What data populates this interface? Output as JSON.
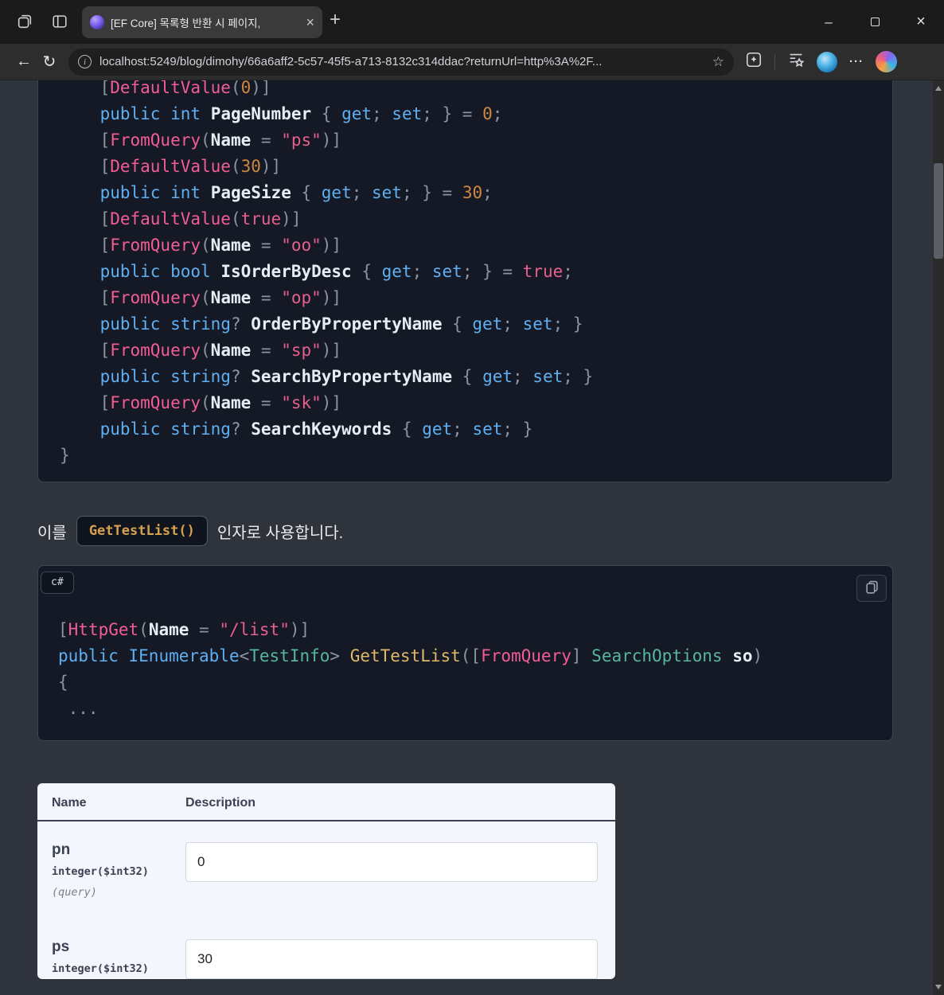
{
  "colors": {
    "page_bg": "#2e333c",
    "code_bg": "#141925",
    "keyword_blue": "#5fb0f2",
    "attribute_pink": "#f25d94",
    "string_pink": "#e5608c",
    "number_orange": "#cf8740",
    "function_gold": "#dfb868",
    "type_teal": "#56b6a2",
    "inline_code_gold": "#d7a14d",
    "table_bg": "#f3f6fc"
  },
  "chrome": {
    "tab": {
      "title": "[EF Core] 목록형 반환 시 페이지,"
    },
    "url": "localhost:5249/blog/dimohy/66a6aff2-5c57-45f5-a713-8132c314ddac?returnUrl=http%3A%2F...",
    "glyphs": {
      "back": "←",
      "refresh": "↻",
      "info": "i",
      "star": "☆",
      "new_tab": "+",
      "tab_close": "×",
      "minimize": "–",
      "window_close": "×",
      "menu": "···"
    }
  },
  "main": {
    "code_block_1": {
      "lines": [
        [
          [
            "pu",
            "    ["
          ],
          [
            "at",
            "DefaultValue"
          ],
          [
            "pu",
            "("
          ],
          [
            "nu",
            "0"
          ],
          [
            "pu",
            ")]"
          ]
        ],
        [
          [
            "pu",
            "    "
          ],
          [
            "kw",
            "public"
          ],
          [
            "pu",
            " "
          ],
          [
            "kw",
            "int"
          ],
          [
            "pu",
            " "
          ],
          [
            "pr",
            "PageNumber"
          ],
          [
            "pu",
            " { "
          ],
          [
            "kw",
            "get"
          ],
          [
            "pu",
            "; "
          ],
          [
            "kw",
            "set"
          ],
          [
            "pu",
            "; } = "
          ],
          [
            "nu",
            "0"
          ],
          [
            "pu",
            ";"
          ]
        ],
        [
          [
            "pu",
            "    ["
          ],
          [
            "at",
            "FromQuery"
          ],
          [
            "pu",
            "("
          ],
          [
            "pr",
            "Name"
          ],
          [
            "pu",
            " = "
          ],
          [
            "st",
            "\"ps\""
          ],
          [
            "pu",
            ")]"
          ]
        ],
        [
          [
            "pu",
            "    ["
          ],
          [
            "at",
            "DefaultValue"
          ],
          [
            "pu",
            "("
          ],
          [
            "nu",
            "30"
          ],
          [
            "pu",
            ")]"
          ]
        ],
        [
          [
            "pu",
            "    "
          ],
          [
            "kw",
            "public"
          ],
          [
            "pu",
            " "
          ],
          [
            "kw",
            "int"
          ],
          [
            "pu",
            " "
          ],
          [
            "pr",
            "PageSize"
          ],
          [
            "pu",
            " { "
          ],
          [
            "kw",
            "get"
          ],
          [
            "pu",
            "; "
          ],
          [
            "kw",
            "set"
          ],
          [
            "pu",
            "; } = "
          ],
          [
            "nu",
            "30"
          ],
          [
            "pu",
            ";"
          ]
        ],
        [
          [
            "pu",
            "    ["
          ],
          [
            "at",
            "DefaultValue"
          ],
          [
            "pu",
            "("
          ],
          [
            "st",
            "true"
          ],
          [
            "pu",
            ")]"
          ]
        ],
        [
          [
            "pu",
            "    ["
          ],
          [
            "at",
            "FromQuery"
          ],
          [
            "pu",
            "("
          ],
          [
            "pr",
            "Name"
          ],
          [
            "pu",
            " = "
          ],
          [
            "st",
            "\"oo\""
          ],
          [
            "pu",
            ")]"
          ]
        ],
        [
          [
            "pu",
            "    "
          ],
          [
            "kw",
            "public"
          ],
          [
            "pu",
            " "
          ],
          [
            "kw",
            "bool"
          ],
          [
            "pu",
            " "
          ],
          [
            "pr",
            "IsOrderByDesc"
          ],
          [
            "pu",
            " { "
          ],
          [
            "kw",
            "get"
          ],
          [
            "pu",
            "; "
          ],
          [
            "kw",
            "set"
          ],
          [
            "pu",
            "; } = "
          ],
          [
            "st",
            "true"
          ],
          [
            "pu",
            ";"
          ]
        ],
        [
          [
            "pu",
            "    ["
          ],
          [
            "at",
            "FromQuery"
          ],
          [
            "pu",
            "("
          ],
          [
            "pr",
            "Name"
          ],
          [
            "pu",
            " = "
          ],
          [
            "st",
            "\"op\""
          ],
          [
            "pu",
            ")]"
          ]
        ],
        [
          [
            "pu",
            "    "
          ],
          [
            "kw",
            "public"
          ],
          [
            "pu",
            " "
          ],
          [
            "kw",
            "string"
          ],
          [
            "pu",
            "? "
          ],
          [
            "pr",
            "OrderByPropertyName"
          ],
          [
            "pu",
            " { "
          ],
          [
            "kw",
            "get"
          ],
          [
            "pu",
            "; "
          ],
          [
            "kw",
            "set"
          ],
          [
            "pu",
            "; }"
          ]
        ],
        [
          [
            "pu",
            "    ["
          ],
          [
            "at",
            "FromQuery"
          ],
          [
            "pu",
            "("
          ],
          [
            "pr",
            "Name"
          ],
          [
            "pu",
            " = "
          ],
          [
            "st",
            "\"sp\""
          ],
          [
            "pu",
            ")]"
          ]
        ],
        [
          [
            "pu",
            "    "
          ],
          [
            "kw",
            "public"
          ],
          [
            "pu",
            " "
          ],
          [
            "kw",
            "string"
          ],
          [
            "pu",
            "? "
          ],
          [
            "pr",
            "SearchByPropertyName"
          ],
          [
            "pu",
            " { "
          ],
          [
            "kw",
            "get"
          ],
          [
            "pu",
            "; "
          ],
          [
            "kw",
            "set"
          ],
          [
            "pu",
            "; }"
          ]
        ],
        [
          [
            "pu",
            "    ["
          ],
          [
            "at",
            "FromQuery"
          ],
          [
            "pu",
            "("
          ],
          [
            "pr",
            "Name"
          ],
          [
            "pu",
            " = "
          ],
          [
            "st",
            "\"sk\""
          ],
          [
            "pu",
            ")]"
          ]
        ],
        [
          [
            "pu",
            "    "
          ],
          [
            "kw",
            "public"
          ],
          [
            "pu",
            " "
          ],
          [
            "kw",
            "string"
          ],
          [
            "pu",
            "? "
          ],
          [
            "pr",
            "SearchKeywords"
          ],
          [
            "pu",
            " { "
          ],
          [
            "kw",
            "get"
          ],
          [
            "pu",
            "; "
          ],
          [
            "kw",
            "set"
          ],
          [
            "pu",
            "; }"
          ]
        ],
        [
          [
            "pu",
            "}"
          ]
        ]
      ]
    },
    "paragraph": {
      "prefix": "이를",
      "inline_code": "GetTestList()",
      "suffix": "인자로 사용합니다."
    },
    "code_block_2": {
      "language": "c#",
      "lines": [
        [
          [
            "pu",
            "["
          ],
          [
            "at",
            "HttpGet"
          ],
          [
            "pu",
            "("
          ],
          [
            "pr",
            "Name"
          ],
          [
            "pu",
            " = "
          ],
          [
            "st",
            "\"/list\""
          ],
          [
            "pu",
            ")]"
          ]
        ],
        [
          [
            "kw",
            "public"
          ],
          [
            "pu",
            " "
          ],
          [
            "ty",
            "IEnumerable"
          ],
          [
            "pu",
            "<"
          ],
          [
            "tn",
            "TestInfo"
          ],
          [
            "pu",
            "> "
          ],
          [
            "fn",
            "GetTestList"
          ],
          [
            "pu",
            "(["
          ],
          [
            "at",
            "FromQuery"
          ],
          [
            "pu",
            "] "
          ],
          [
            "tn",
            "SearchOptions"
          ],
          [
            "pu",
            " "
          ],
          [
            "pr",
            "so"
          ],
          [
            "pu",
            ")"
          ]
        ],
        [
          [
            "pu",
            "{"
          ]
        ],
        [
          [
            "pu",
            " ..."
          ]
        ]
      ]
    },
    "params_table": {
      "headers": [
        "Name",
        "Description"
      ],
      "rows": [
        {
          "name": "pn",
          "type": "integer($int32)",
          "location": "(query)",
          "value": "0"
        },
        {
          "name": "ps",
          "type": "integer($int32)",
          "value": "30"
        }
      ]
    }
  }
}
